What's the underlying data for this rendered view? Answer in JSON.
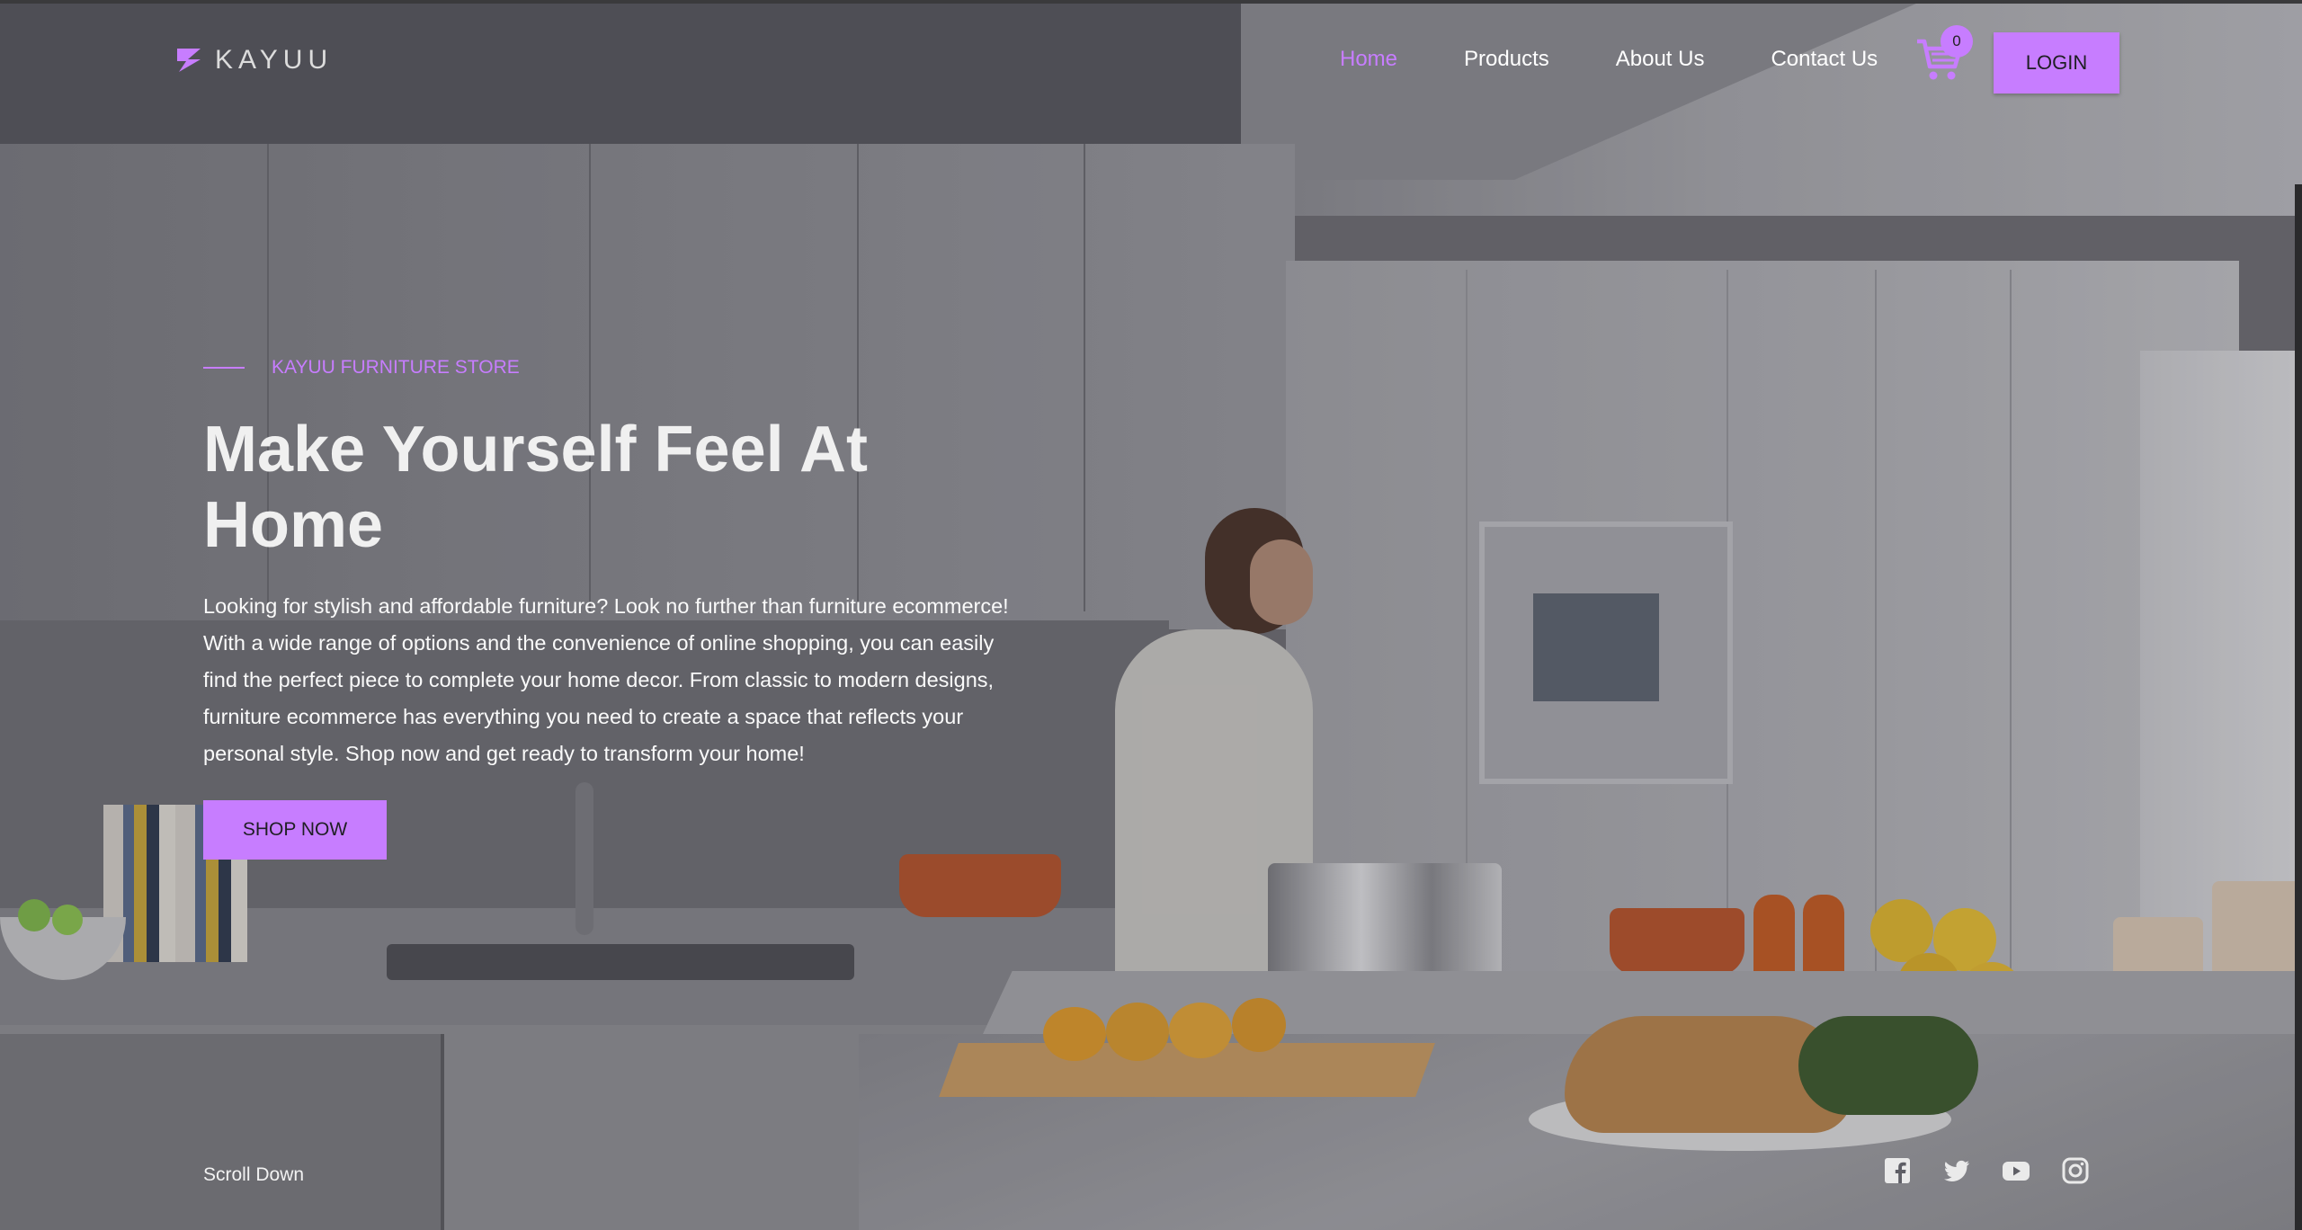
{
  "brand": {
    "name": "KAYUU",
    "logo_icon": "kayuu-logo-icon",
    "accent_color": "#c77dff"
  },
  "nav": {
    "items": [
      {
        "label": "Home",
        "active": true
      },
      {
        "label": "Products",
        "active": false
      },
      {
        "label": "About Us",
        "active": false
      },
      {
        "label": "Contact Us",
        "active": false
      }
    ],
    "cart": {
      "icon": "cart-icon",
      "count": "0"
    },
    "login_label": "LOGIN"
  },
  "hero": {
    "eyebrow": "KAYUU FURNITURE STORE",
    "headline": "Make Yourself Feel At Home",
    "description": "Looking for stylish and affordable furniture? Look no further than furniture ecommerce! With a wide range of options and the convenience of online shopping, you can easily find the perfect piece to complete your home decor. From classic to modern designs, furniture ecommerce has everything you need to create a space that reflects your personal style. Shop now and get ready to transform your home!",
    "cta_label": "SHOP NOW",
    "background": "kitchen-photo"
  },
  "footer": {
    "scroll_label": "Scroll Down",
    "social": [
      "facebook-icon",
      "twitter-icon",
      "youtube-icon",
      "instagram-icon"
    ]
  }
}
